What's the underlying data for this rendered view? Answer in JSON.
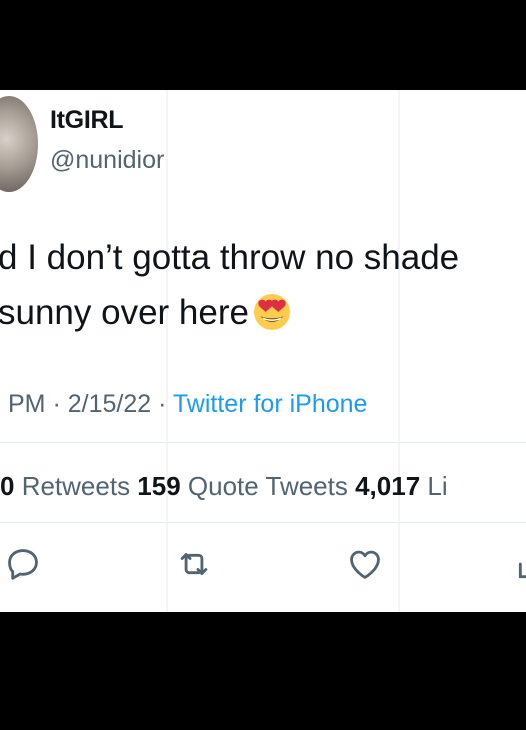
{
  "user": {
    "display_name": "ItGIRL",
    "handle": "@nunidior"
  },
  "tweet": {
    "line1": "d I don’t gotta throw no shade",
    "line2": " sunny over here",
    "emoji": "smiling-face-with-heart-eyes"
  },
  "meta": {
    "time": "PM",
    "sep1": " · ",
    "date": "2/15/22",
    "sep2": " · ",
    "source": "Twitter for iPhone"
  },
  "stats": {
    "retweets_count": "0",
    "retweets_label": " Retweets ",
    "quotes_count": "159",
    "quotes_label": " Quote Tweets ",
    "likes_count": "4,017",
    "likes_label": " Li"
  },
  "actions": {
    "reply": "reply-icon",
    "retweet": "retweet-icon",
    "like": "heart-icon",
    "share": "share-icon"
  },
  "colors": {
    "text": "#0f1419",
    "secondary": "#536471",
    "link": "#1d9bf0"
  }
}
